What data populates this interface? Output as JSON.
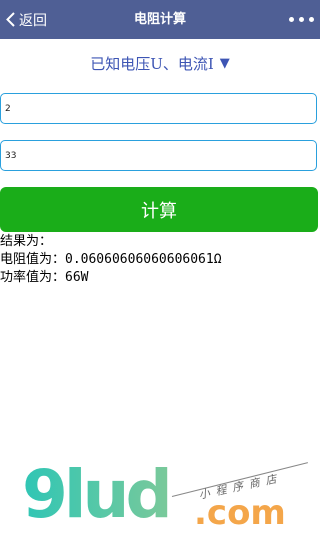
{
  "navbar": {
    "back_label": "返回",
    "title": "电阻计算"
  },
  "mode_select": {
    "label": "已知电压U、电流I",
    "arrow": "▼"
  },
  "inputs": {
    "voltage_value": "2",
    "current_value": "33"
  },
  "calculate_button": "计算",
  "results": {
    "header": "结果为：",
    "resistance_line": "电阻值为：0.06060606060606061Ω",
    "power_line": "功率值为：66W"
  },
  "watermark": {
    "logo_text": "9lud",
    "domain_text": ".com",
    "tagline": "小程序商店"
  },
  "colors": {
    "navbar": "#4f5f95",
    "accent_blue": "#3d55b4",
    "input_border": "#2aa0dd",
    "button_green": "#1aad19"
  }
}
